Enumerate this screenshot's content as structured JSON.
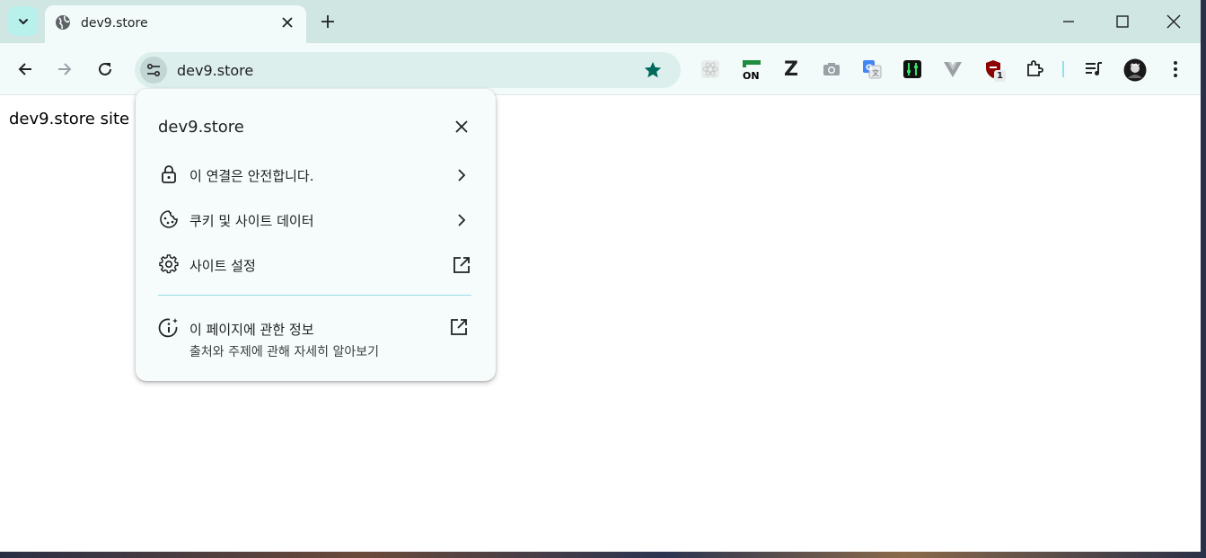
{
  "tab": {
    "title": "dev9.store"
  },
  "omnibox": {
    "url": "dev9.store"
  },
  "extensions": {
    "badge_count": "1",
    "on_label": "ON",
    "z_label": "Z"
  },
  "page": {
    "text": "dev9.store site"
  },
  "site_info_popup": {
    "title": "dev9.store",
    "items": [
      {
        "label": "이 연결은 안전합니다.",
        "icon": "lock-icon",
        "trailing": "chevron-right-icon"
      },
      {
        "label": "쿠키 및 사이트 데이터",
        "icon": "cookie-icon",
        "trailing": "chevron-right-icon"
      },
      {
        "label": "사이트 설정",
        "icon": "gear-icon",
        "trailing": "open-external-icon"
      }
    ],
    "about": {
      "label": "이 페이지에 관한 정보",
      "sublabel": "출처와 주제에 관해 자세히 알아보기",
      "icon": "info-sparkle-icon",
      "trailing": "open-external-icon"
    }
  },
  "colors": {
    "accent": "#00695c",
    "tabstrip": "#cfe6e3",
    "toolbar": "#f3fbfa",
    "omnibox": "#dcefed"
  }
}
